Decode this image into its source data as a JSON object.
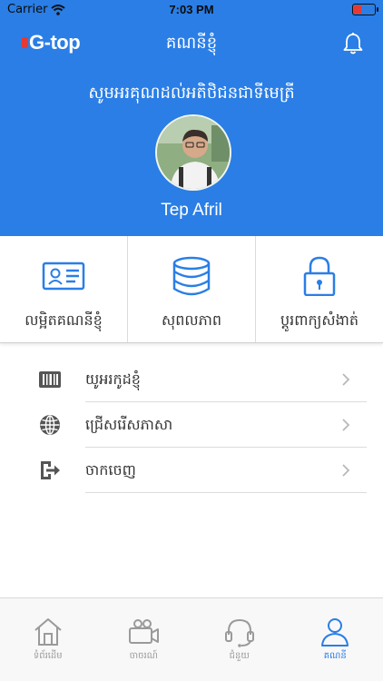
{
  "status_bar": {
    "carrier": "Carrier",
    "time": "7:03 PM"
  },
  "nav": {
    "logo_text": "G-top",
    "title": "គណនីខ្ញុំ",
    "bell_icon": "bell-icon"
  },
  "profile": {
    "welcome": "សូមអរគុណដល់អតិថិជនជាទីមេត្រី",
    "name": "Tep Afril"
  },
  "tiles": [
    {
      "icon": "id-card-icon",
      "label": "លម្អិតគណនីខ្ញុំ"
    },
    {
      "icon": "database-icon",
      "label": "សុពលភាព"
    },
    {
      "icon": "lock-icon",
      "label": "ប្តូរពាក្យសំងាត់"
    }
  ],
  "menu": [
    {
      "icon": "barcode-icon",
      "label": "យូអរកូដខ្ញុំ"
    },
    {
      "icon": "globe-icon",
      "label": "ជ្រើសរើសភាសា"
    },
    {
      "icon": "logout-icon",
      "label": "ចាកចេញ"
    }
  ],
  "tabs": [
    {
      "icon": "home-icon",
      "label": "ទំព័រដើម"
    },
    {
      "icon": "video-icon",
      "label": "ចាចរណ៍"
    },
    {
      "icon": "headset-icon",
      "label": "ជំនួយ"
    },
    {
      "icon": "user-icon",
      "label": "គណនី",
      "active": true
    }
  ],
  "colors": {
    "brand_blue": "#2a7ee6",
    "battery_red": "#e53935",
    "icon_gray": "#555555",
    "tab_gray": "#9a9a9a"
  }
}
